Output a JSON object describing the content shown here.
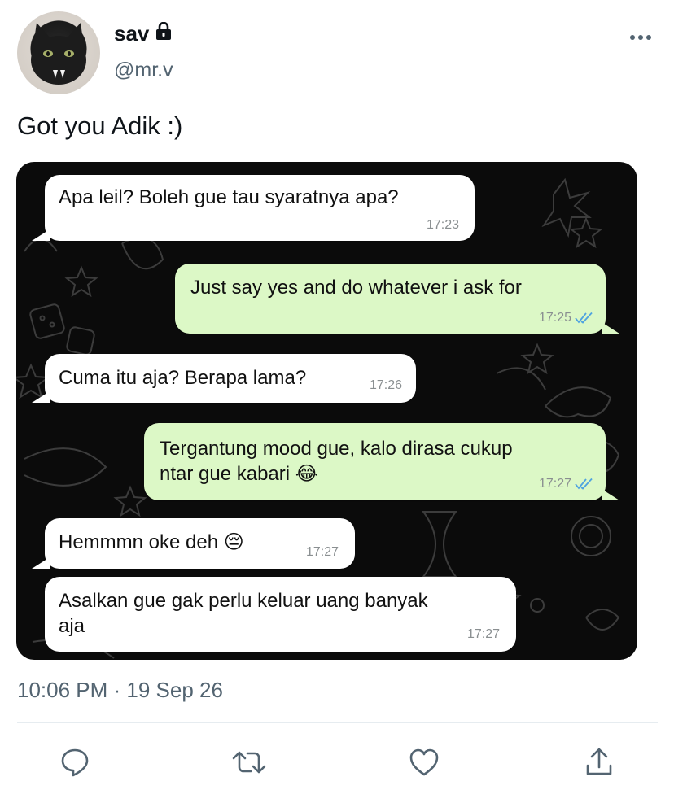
{
  "author": {
    "name": "sav",
    "handle": "@mr.v",
    "protected_icon": "lock-icon",
    "avatar_icon": "black-cat-avatar"
  },
  "tweet": {
    "text": "Got you Adik :)",
    "timestamp": "10:06 PM · 19 Sep 26"
  },
  "chat": {
    "background": "#0b0b0b",
    "incoming_color": "#ffffff",
    "outgoing_color": "#dcf8c6",
    "tick_color": "#4fa3e0",
    "messages": [
      {
        "direction": "in",
        "line1": "Apa leil? Boleh gue tau syaratnya apa?",
        "line2": "",
        "emoji": "",
        "time": "17:23"
      },
      {
        "direction": "out",
        "line1": "Just say yes and do whatever i ask for",
        "line2": "",
        "emoji": "",
        "time": "17:25",
        "read": true
      },
      {
        "direction": "in",
        "line1": "Cuma itu aja? Berapa lama?",
        "line2": "",
        "emoji": "",
        "time": "17:26"
      },
      {
        "direction": "out",
        "line1": "Tergantung mood gue, kalo dirasa cukup",
        "line2": "ntar gue kabari",
        "emoji": "😂",
        "time": "17:27",
        "read": true
      },
      {
        "direction": "in",
        "line1": "Hemmmn oke deh",
        "line2": "",
        "emoji": "😔",
        "time": "17:27"
      },
      {
        "direction": "in",
        "line1": "Asalkan gue gak perlu keluar uang banyak",
        "line2": "aja",
        "emoji": "",
        "time": "17:27"
      }
    ]
  },
  "actions": {
    "reply_icon": "reply-icon",
    "retweet_icon": "retweet-icon",
    "like_icon": "heart-icon",
    "share_icon": "share-icon",
    "more_icon": "more-icon"
  }
}
